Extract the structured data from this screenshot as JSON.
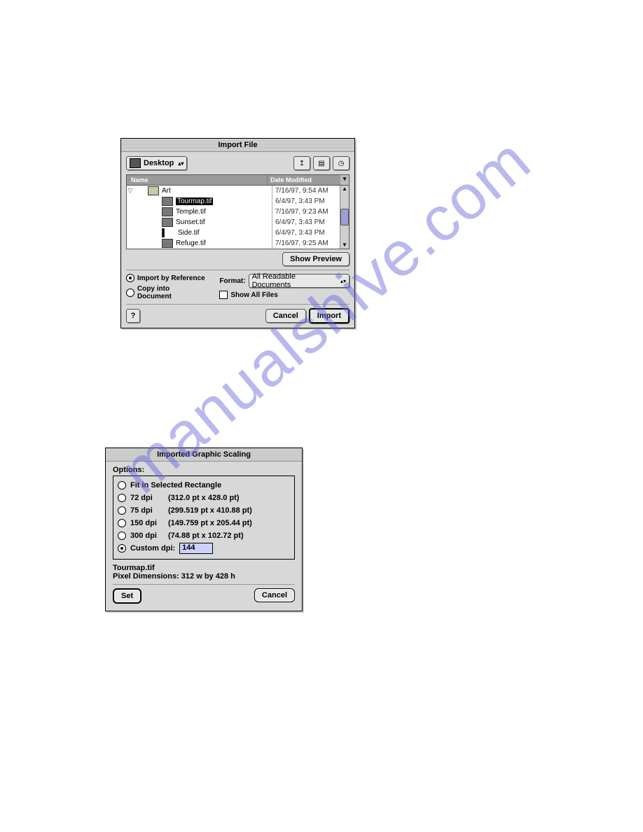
{
  "watermark": "manualshive.com",
  "import": {
    "title": "Import File",
    "location": "Desktop",
    "columns": {
      "name": "Name",
      "date": "Date Modified"
    },
    "rows": [
      {
        "indent": 0,
        "icon": "folder",
        "name": "Art",
        "selected": false,
        "expanded": true,
        "date": "7/16/97, 9:54 AM"
      },
      {
        "indent": 1,
        "icon": "file",
        "name": "Tourmap.tif",
        "selected": true,
        "date": "6/4/97, 3:43 PM"
      },
      {
        "indent": 1,
        "icon": "file",
        "name": "Temple.tif",
        "selected": false,
        "date": "7/16/97, 9:23 AM"
      },
      {
        "indent": 1,
        "icon": "file",
        "name": "Sunset.tif",
        "selected": false,
        "date": "6/4/97, 3:43 PM"
      },
      {
        "indent": 1,
        "icon": "file",
        "name": "Side.tif",
        "selected": false,
        "date": "6/4/97, 3:43 PM"
      },
      {
        "indent": 1,
        "icon": "file",
        "name": "Refuge.tif",
        "selected": false,
        "date": "7/16/97, 9:25 AM"
      }
    ],
    "show_preview": "Show Preview",
    "import_by_ref": "Import by Reference",
    "copy_into_doc": "Copy into Document",
    "format_label": "Format:",
    "format_value": "All Readable Documents",
    "show_all_files": "Show All Files",
    "help": "?",
    "cancel": "Cancel",
    "import_btn": "Import"
  },
  "scale": {
    "title": "Imported Graphic Scaling",
    "options_label": "Options:",
    "fit": "Fit in Selected Rectangle",
    "dpi72": {
      "label": "72 dpi",
      "dims": "(312.0 pt x 428.0 pt)"
    },
    "dpi75": {
      "label": "75 dpi",
      "dims": "(299.519 pt x 410.88 pt)"
    },
    "dpi150": {
      "label": "150 dpi",
      "dims": "(149.759 pt x 205.44 pt)"
    },
    "dpi300": {
      "label": "300 dpi",
      "dims": "(74.88 pt x 102.72 pt)"
    },
    "custom_label": "Custom dpi:",
    "custom_value": "144",
    "filename": "Tourmap.tif",
    "pixel_dims": "Pixel Dimensions: 312 w by 428 h",
    "set": "Set",
    "cancel": "Cancel"
  }
}
